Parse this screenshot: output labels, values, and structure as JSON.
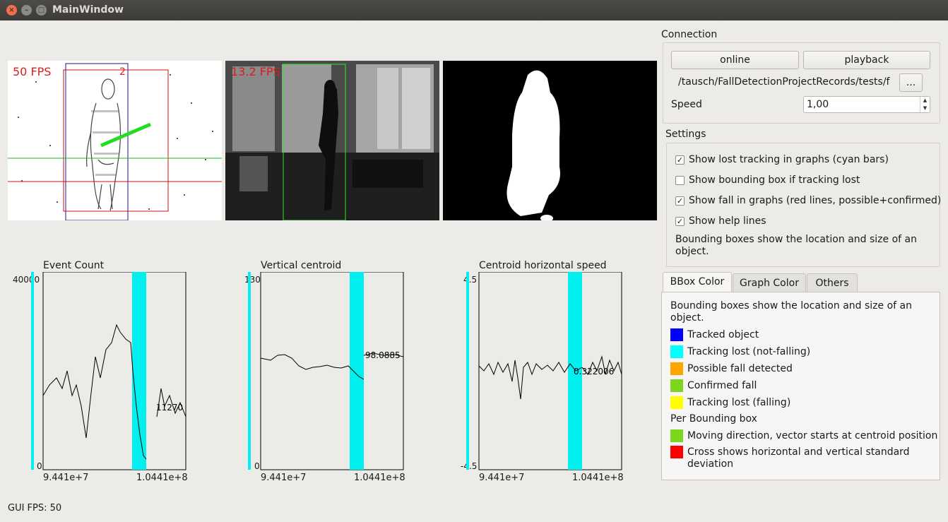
{
  "window": {
    "title": "MainWindow"
  },
  "views": {
    "events_fps": "50 FPS",
    "events_id": "2",
    "camera_fps": "13.2 FPS"
  },
  "graphs": [
    {
      "title": "Event Count",
      "ymax": "40000",
      "ymin": "0",
      "xmin": "9.441e+7",
      "xmax": "1.0441e+8",
      "value": "11270"
    },
    {
      "title": "Vertical centroid",
      "ymax": "130",
      "ymin": "0",
      "xmin": "9.441e+7",
      "xmax": "1.0441e+8",
      "value": "98.0885"
    },
    {
      "title": "Centroid horizontal speed",
      "ymax": "4.5",
      "ymin": "-4.5",
      "xmin": "9.441e+7",
      "xmax": "1.0441e+8",
      "value": "0.322006"
    }
  ],
  "connection": {
    "title": "Connection",
    "online_label": "online",
    "playback_label": "playback",
    "path": "/tausch/FallDetectionProjectRecords/tests/f",
    "browse_label": "...",
    "speed_label": "Speed",
    "speed_value": "1,00"
  },
  "settings": {
    "title": "Settings",
    "options": [
      {
        "label": "Show lost tracking in graphs (cyan bars)",
        "checked": "✓"
      },
      {
        "label": "Show bounding box if tracking lost",
        "checked": ""
      },
      {
        "label": "Show fall in graphs (red lines, possible+confirmed)",
        "checked": "✓"
      },
      {
        "label": "Show help lines",
        "checked": "✓"
      }
    ],
    "note_line1": "Bounding boxes show the location and size of an",
    "note_line2": "object."
  },
  "tabs": [
    "BBox Color",
    "Graph Color",
    "Others"
  ],
  "bbox_panel": {
    "intro_line1": "Bounding boxes show the location and size of an",
    "intro_line2": "object.",
    "items": [
      {
        "label": "Tracked object",
        "color": "#0000ff"
      },
      {
        "label": "Tracking lost (not-falling)",
        "color": "#00ffff"
      },
      {
        "label": "Possible fall detected",
        "color": "#ffa500"
      },
      {
        "label": "Confirmed fall",
        "color": "#7cd61e"
      },
      {
        "label": "Tracking lost (falling)",
        "color": "#ffff00"
      }
    ],
    "per_bbox_title": "Per Bounding box",
    "per_items": [
      {
        "label": "Moving direction, vector starts at centroid position",
        "color": "#7cd61e"
      },
      {
        "label_line1": "Cross shows horizontal and vertical standard",
        "label_line2": "deviation",
        "color": "#ff0000"
      }
    ]
  },
  "status": {
    "gui_fps": "GUI FPS: 50"
  }
}
